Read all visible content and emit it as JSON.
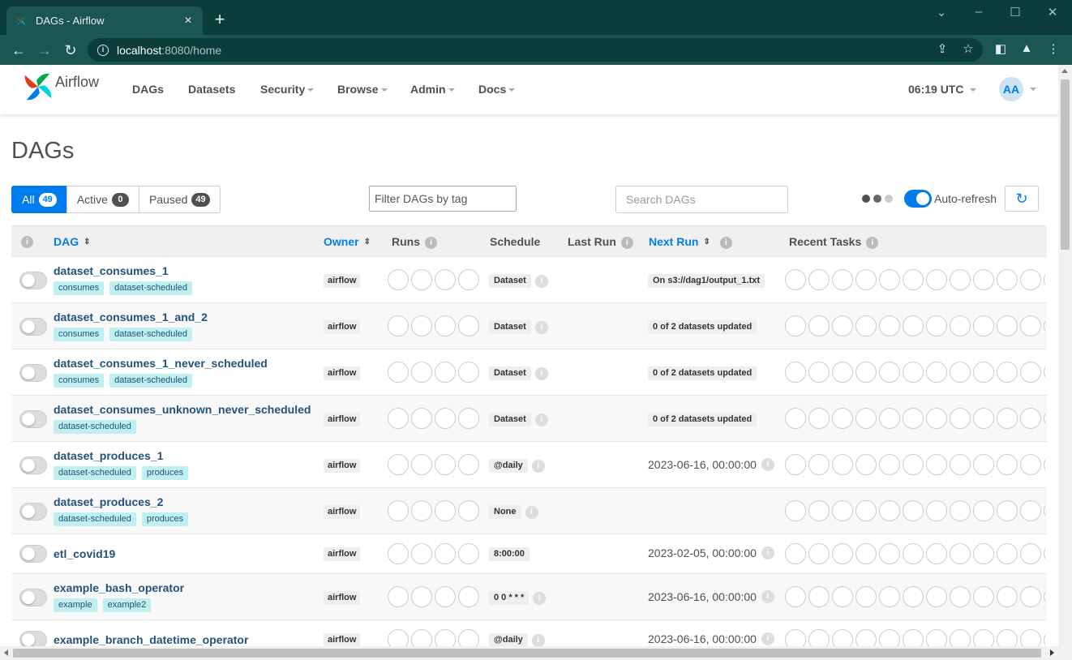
{
  "browser": {
    "tab_title": "DAGs - Airflow",
    "url_host": "localhost",
    "url_rest": ":8080/home"
  },
  "navbar": {
    "brand": "Airflow",
    "items": [
      {
        "label": "DAGs",
        "dropdown": false
      },
      {
        "label": "Datasets",
        "dropdown": false
      },
      {
        "label": "Security",
        "dropdown": true
      },
      {
        "label": "Browse",
        "dropdown": true
      },
      {
        "label": "Admin",
        "dropdown": true
      },
      {
        "label": "Docs",
        "dropdown": true
      }
    ],
    "clock": "06:19 UTC",
    "avatar_initials": "AA"
  },
  "page_title": "DAGs",
  "status_tabs": [
    {
      "label": "All",
      "count": "49"
    },
    {
      "label": "Active",
      "count": "0"
    },
    {
      "label": "Paused",
      "count": "49"
    }
  ],
  "filters": {
    "tag_placeholder": "Filter DAGs by tag",
    "search_placeholder": "Search DAGs",
    "autorefresh_label": "Auto-refresh",
    "autorefresh_on": true
  },
  "table": {
    "headers": {
      "dag": "DAG",
      "owner": "Owner",
      "runs": "Runs",
      "schedule": "Schedule",
      "last_run": "Last Run",
      "next_run": "Next Run",
      "recent_tasks": "Recent Tasks"
    },
    "rows": [
      {
        "dag_id": "dataset_consumes_1",
        "tags": [
          "consumes",
          "dataset-scheduled"
        ],
        "owner": "airflow",
        "schedule": "Dataset",
        "next_run": "On s3://dag1/output_1.txt",
        "next_run_badge": true
      },
      {
        "dag_id": "dataset_consumes_1_and_2",
        "tags": [
          "consumes",
          "dataset-scheduled"
        ],
        "owner": "airflow",
        "schedule": "Dataset",
        "next_run": "0 of 2 datasets updated",
        "next_run_badge": true
      },
      {
        "dag_id": "dataset_consumes_1_never_scheduled",
        "tags": [
          "consumes",
          "dataset-scheduled"
        ],
        "owner": "airflow",
        "schedule": "Dataset",
        "next_run": "0 of 2 datasets updated",
        "next_run_badge": true
      },
      {
        "dag_id": "dataset_consumes_unknown_never_scheduled",
        "tags": [
          "dataset-scheduled"
        ],
        "owner": "airflow",
        "schedule": "Dataset",
        "next_run": "0 of 2 datasets updated",
        "next_run_badge": true
      },
      {
        "dag_id": "dataset_produces_1",
        "tags": [
          "dataset-scheduled",
          "produces"
        ],
        "owner": "airflow",
        "schedule": "@daily",
        "next_run": "2023-06-16, 00:00:00",
        "next_run_badge": false
      },
      {
        "dag_id": "dataset_produces_2",
        "tags": [
          "dataset-scheduled",
          "produces"
        ],
        "owner": "airflow",
        "schedule": "None",
        "next_run": "",
        "next_run_badge": false
      },
      {
        "dag_id": "etl_covid19",
        "tags": [],
        "owner": "airflow",
        "schedule": "8:00:00",
        "schedule_info": false,
        "next_run": "2023-02-05, 00:00:00",
        "next_run_badge": false
      },
      {
        "dag_id": "example_bash_operator",
        "tags": [
          "example",
          "example2"
        ],
        "owner": "airflow",
        "schedule": "0 0 * * *",
        "next_run": "2023-06-16, 00:00:00",
        "next_run_badge": false
      },
      {
        "dag_id": "example_branch_datetime_operator",
        "tags": [],
        "owner": "airflow",
        "schedule": "@daily",
        "next_run": "2023-06-16, 00:00:00",
        "next_run_badge": false
      }
    ]
  }
}
